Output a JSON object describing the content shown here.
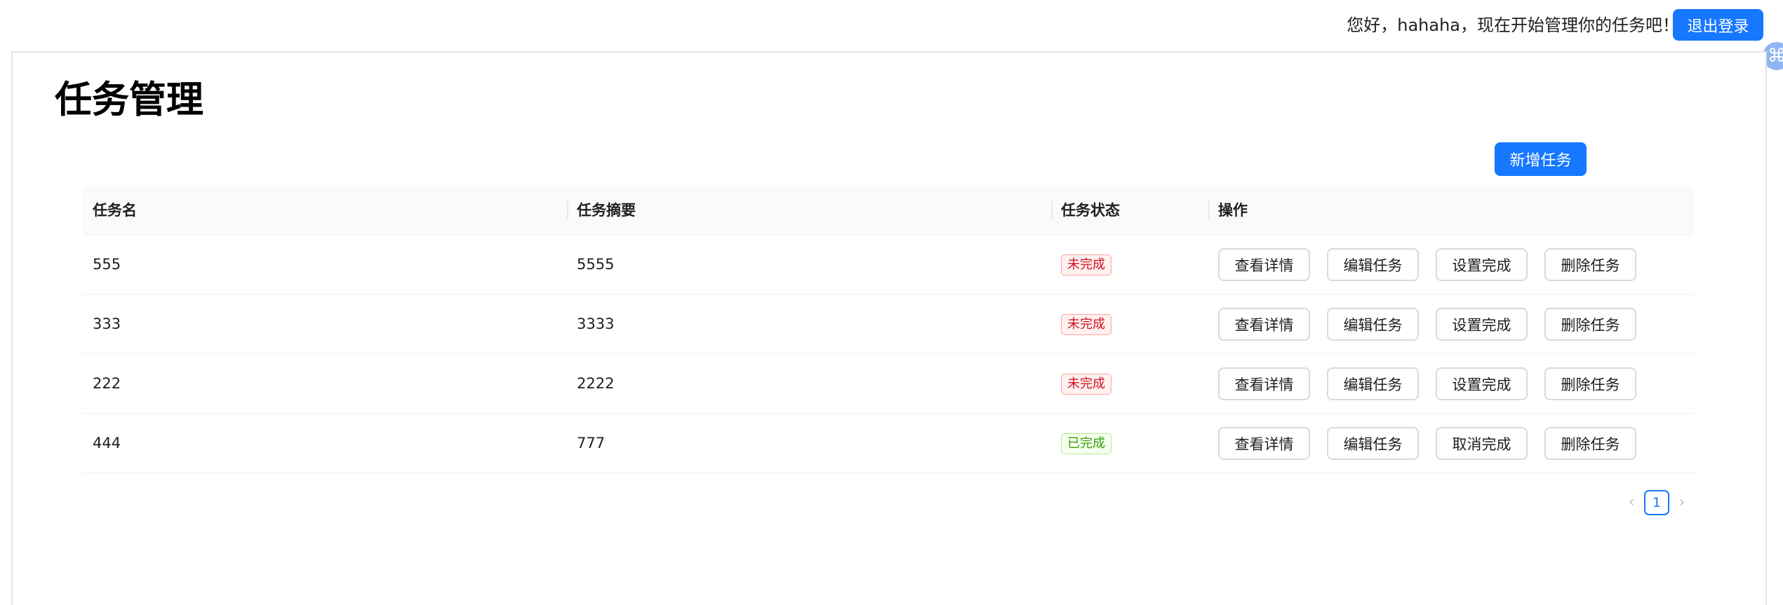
{
  "header": {
    "greeting": "您好，hahaha，现在开始管理你的任务吧！",
    "logout_label": "退出登录",
    "float_icon": "command-icon",
    "float_glyph": "⌘"
  },
  "page": {
    "title": "任务管理",
    "add_label": "新增任务"
  },
  "table": {
    "columns": [
      "任务名",
      "任务摘要",
      "任务状态",
      "操作"
    ],
    "rows": [
      {
        "name": "555",
        "summary": "5555",
        "status": "未完成",
        "status_color": "red",
        "ops": [
          "查看详情",
          "编辑任务",
          "设置完成",
          "删除任务"
        ]
      },
      {
        "name": "333",
        "summary": "3333",
        "status": "未完成",
        "status_color": "red",
        "ops": [
          "查看详情",
          "编辑任务",
          "设置完成",
          "删除任务"
        ]
      },
      {
        "name": "222",
        "summary": "2222",
        "status": "未完成",
        "status_color": "red",
        "ops": [
          "查看详情",
          "编辑任务",
          "设置完成",
          "删除任务"
        ]
      },
      {
        "name": "444",
        "summary": "777",
        "status": "已完成",
        "status_color": "green",
        "ops": [
          "查看详情",
          "编辑任务",
          "取消完成",
          "删除任务"
        ]
      }
    ]
  },
  "pagination": {
    "prev": "‹",
    "current": "1",
    "next": "›"
  },
  "colors": {
    "primary": "#1677ff",
    "tag_red": "#cf1322",
    "tag_green": "#389e0d"
  }
}
